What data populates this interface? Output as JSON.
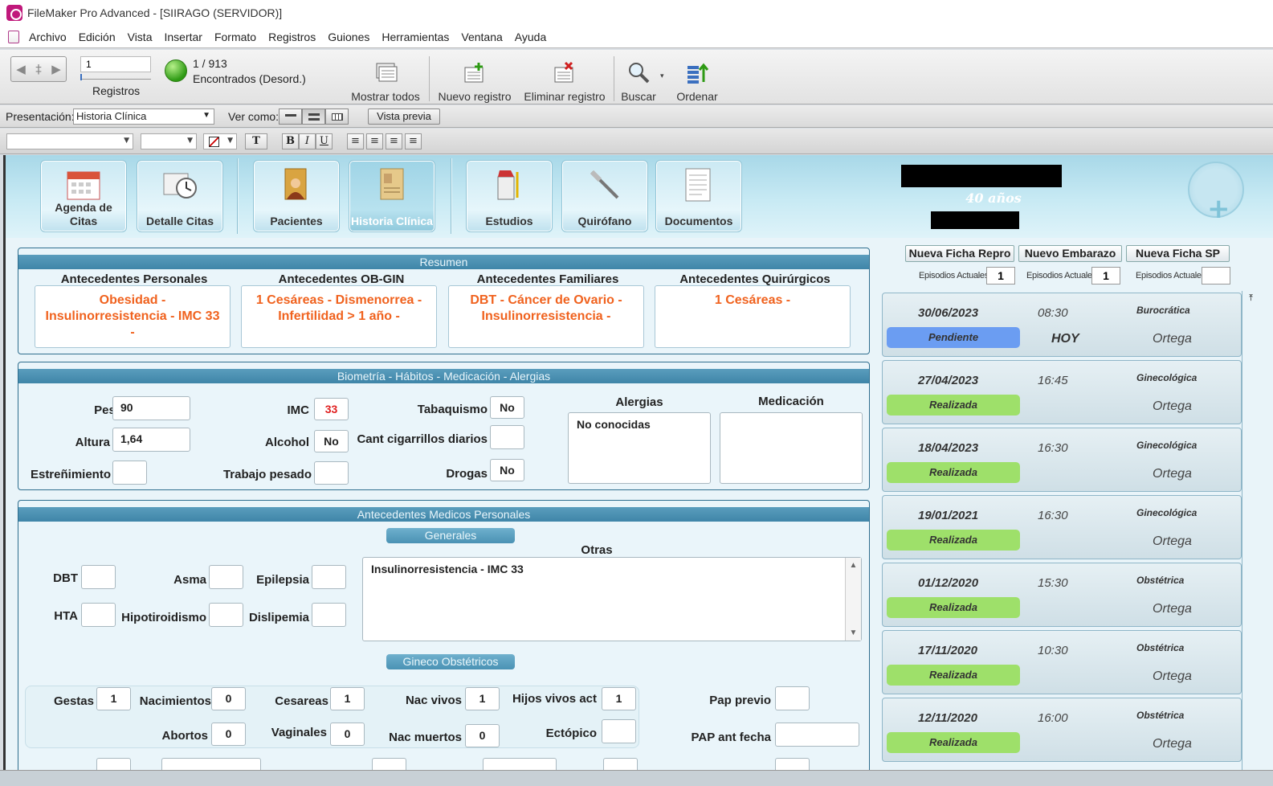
{
  "window": {
    "title": "FileMaker Pro Advanced - [SIIRAGO (SERVIDOR)]"
  },
  "menu": [
    "Archivo",
    "Edición",
    "Vista",
    "Insertar",
    "Formato",
    "Registros",
    "Guiones",
    "Herramientas",
    "Ventana",
    "Ayuda"
  ],
  "status": {
    "record_input": "1",
    "records_label": "Registros",
    "found_count": "1 / 913",
    "found_label": "Encontrados (Desord.)",
    "buttons": {
      "show_all": "Mostrar todos",
      "new_record": "Nuevo registro",
      "delete_record": "Eliminar registro",
      "find": "Buscar",
      "sort": "Ordenar"
    }
  },
  "layout_bar": {
    "label": "Presentación:",
    "selected": "Historia Clínica",
    "view_as_label": "Ver como:",
    "preview_button": "Vista previa"
  },
  "nav_tabs": [
    "Agenda de Citas",
    "Detalle Citas",
    "Pacientes",
    "Historia Clínica",
    "Estudios",
    "Quirófano",
    "Documentos"
  ],
  "patient": {
    "age": "40 años"
  },
  "resumen": {
    "title": "Resumen",
    "columns": [
      {
        "title": "Antecedentes Personales",
        "value": "Obesidad - Insulinorresistencia -  IMC 33 -"
      },
      {
        "title": "Antecedentes OB-GIN",
        "value": "1 Cesáreas - Dismenorrea - Infertilidad > 1 año -"
      },
      {
        "title": "Antecedentes Familiares",
        "value": "DBT - Cáncer de Ovario - Insulinorresistencia -"
      },
      {
        "title": "Antecedentes Quirúrgicos",
        "value": "1 Cesáreas -"
      }
    ]
  },
  "biometria": {
    "title": "Biometría -  Hábitos - Medicación - Alergias",
    "peso_label": "Peso",
    "peso": "90",
    "altura_label": "Altura",
    "altura": "1,64",
    "estrenimiento_label": "Estreñimiento",
    "estrenimiento": "",
    "imc_label": "IMC",
    "imc": "33",
    "alcohol_label": "Alcohol",
    "alcohol": "No",
    "trabajo_label": "Trabajo pesado",
    "trabajo": "",
    "tabaquismo_label": "Tabaquismo",
    "tabaquismo": "No",
    "cigarrillos_label": "Cant cigarrillos diarios",
    "cigarrillos": "",
    "drogas_label": "Drogas",
    "drogas": "No",
    "alergias_label": "Alergias",
    "alergias": "No conocidas",
    "medicacion_label": "Medicación",
    "medicacion": ""
  },
  "amp": {
    "title": "Antecedentes Medicos Personales",
    "generales_label": "Generales",
    "dbt_label": "DBT",
    "asma_label": "Asma",
    "epilepsia_label": "Epilepsia",
    "hta_label": "HTA",
    "hipotiroidismo_label": "Hipotiroidismo",
    "dislipemia_label": "Dislipemia",
    "otras_label": "Otras",
    "otras": "Insulinorresistencia -  IMC 33",
    "gineco_label": "Gineco Obstétricos",
    "gestas_label": "Gestas",
    "gestas": "1",
    "nacimientos_label": "Nacimientos",
    "nacimientos": "0",
    "cesareas_label": "Cesareas",
    "cesareas": "1",
    "nac_vivos_label": "Nac vivos",
    "nac_vivos": "1",
    "hijos_vivos_label": "Hijos vivos act",
    "hijos_vivos": "1",
    "abortos_label": "Abortos",
    "abortos": "0",
    "vaginales_label": "Vaginales",
    "vaginales": "0",
    "nac_muertos_label": "Nac muertos",
    "nac_muertos": "0",
    "ectopico_label": "Ectópico",
    "ectopico": "",
    "pap_previo_label": "Pap previo",
    "pap_previo": "",
    "pap_ant_label": "PAP ant fecha",
    "pap_ant": ""
  },
  "right_panel": {
    "buttons": [
      "Nueva Ficha Repro",
      "Nuevo Embarazo",
      "Nueva Ficha SP"
    ],
    "episodes_label": "Episodios Actuales",
    "episodes": [
      "1",
      "1",
      ""
    ]
  },
  "appointments": [
    {
      "date": "30/06/2023",
      "time": "08:30",
      "type": "Burocrática",
      "status": "Pendiente",
      "today": "HOY",
      "doctor": "Ortega"
    },
    {
      "date": "27/04/2023",
      "time": "16:45",
      "type": "Ginecológica",
      "status": "Realizada",
      "today": "",
      "doctor": "Ortega"
    },
    {
      "date": "18/04/2023",
      "time": "16:30",
      "type": "Ginecológica",
      "status": "Realizada",
      "today": "",
      "doctor": "Ortega"
    },
    {
      "date": "19/01/2021",
      "time": "16:30",
      "type": "Ginecológica",
      "status": "Realizada",
      "today": "",
      "doctor": "Ortega"
    },
    {
      "date": "01/12/2020",
      "time": "15:30",
      "type": "Obstétrica",
      "status": "Realizada",
      "today": "",
      "doctor": "Ortega"
    },
    {
      "date": "17/11/2020",
      "time": "10:30",
      "type": "Obstétrica",
      "status": "Realizada",
      "today": "",
      "doctor": "Ortega"
    },
    {
      "date": "12/11/2020",
      "time": "16:00",
      "type": "Obstétrica",
      "status": "Realizada",
      "today": "",
      "doctor": "Ortega"
    }
  ],
  "colors": {
    "pending": "#6b9df2",
    "done": "#9ee06a",
    "accent_orange": "#f0621e",
    "header_blue": "#3f85a8"
  }
}
